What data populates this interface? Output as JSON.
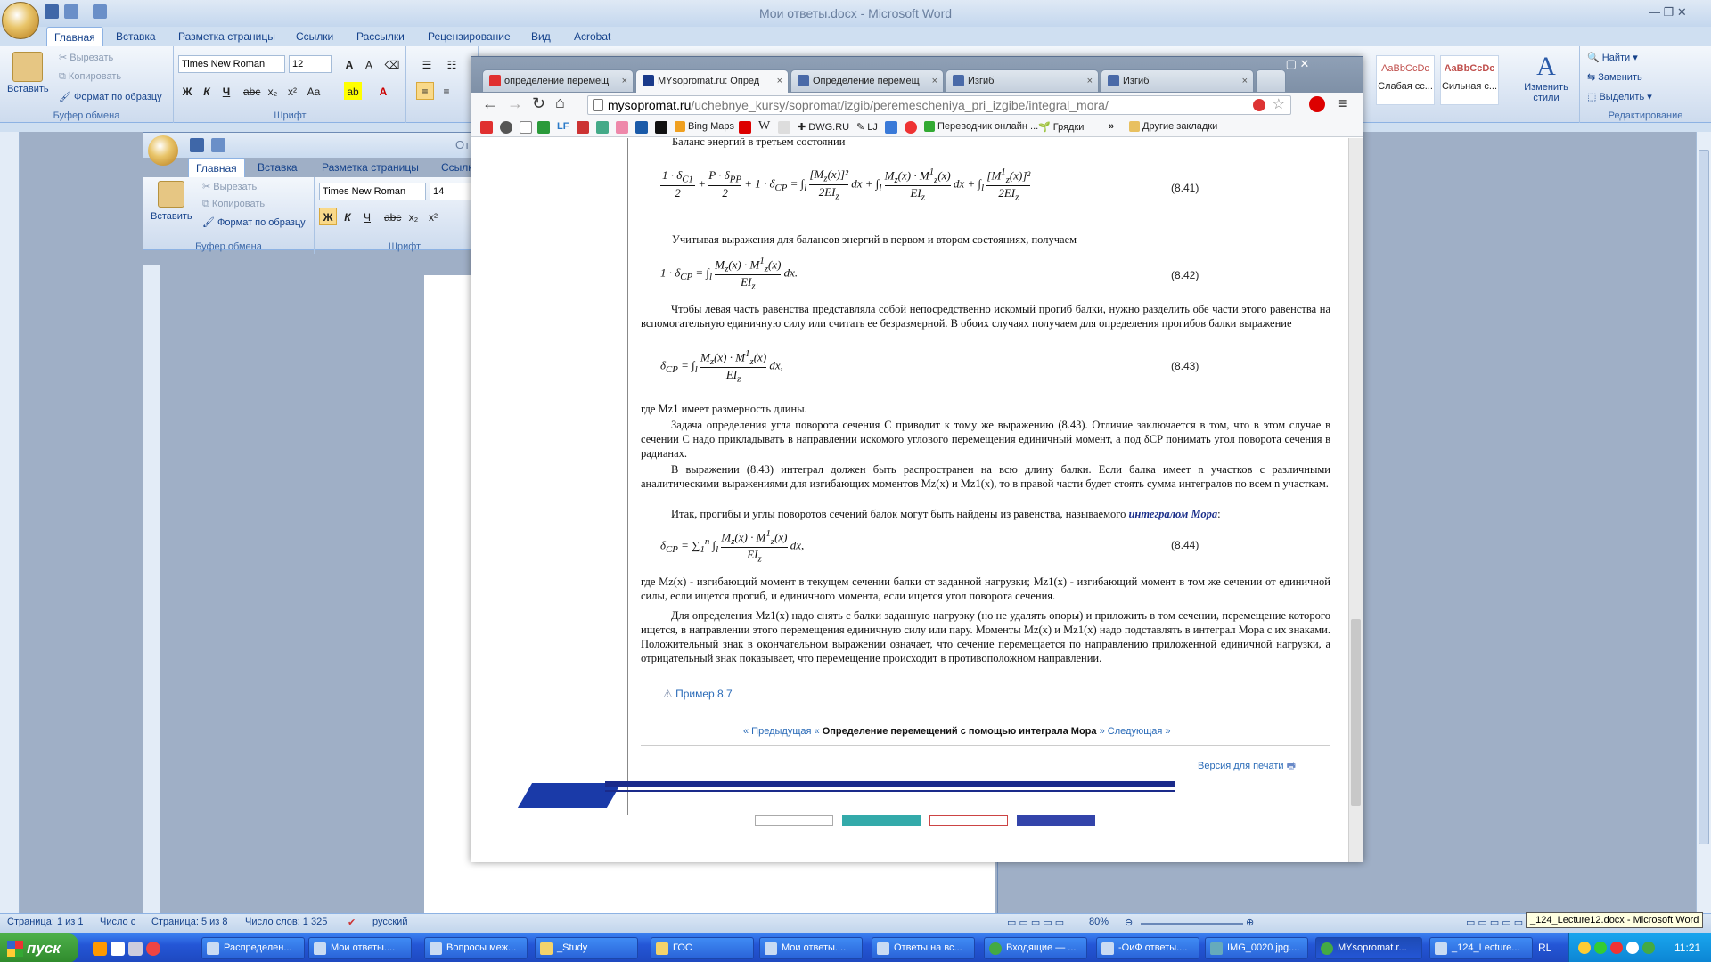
{
  "word_main": {
    "title": "Мои ответы.docx - Microsoft Word",
    "tabs": [
      "Главная",
      "Вставка",
      "Разметка страницы",
      "Ссылки",
      "Рассылки",
      "Рецензирование",
      "Вид",
      "Acrobat"
    ],
    "clipboard": {
      "paste": "Вставить",
      "cut": "Вырезать",
      "copy": "Копировать",
      "format": "Формат по образцу",
      "label": "Буфер обмена"
    },
    "font": {
      "name": "Times New Roman",
      "size": "12",
      "label": "Шрифт"
    },
    "styles": [
      {
        "sample": "AaBbCcDc",
        "name": "Слабая сс..."
      },
      {
        "sample": "AaBbCcDc",
        "name": "Сильная с..."
      }
    ],
    "change_styles": "Изменить стили",
    "editing": {
      "find": "Найти",
      "replace": "Заменить",
      "select": "Выделить",
      "label": "Редактирование"
    },
    "status": {
      "page": "Страница: 1 из 1",
      "number": "Число с",
      "page2": "Страница: 5 из 8",
      "words": "Число слов: 1 325",
      "lang": "русский",
      "zoom": "80%"
    },
    "tooltip": "_124_Lecture12.docx - Microsoft Word"
  },
  "word_second": {
    "title": "От",
    "tabs": [
      "Главная",
      "Вставка",
      "Разметка страницы",
      "Ссылк"
    ],
    "clipboard": {
      "paste": "Вставить",
      "cut": "Вырезать",
      "copy": "Копировать",
      "format": "Формат по образцу",
      "label": "Буфер обмена"
    },
    "font": {
      "name": "Times New Roman",
      "size": "14",
      "label": "Шрифт"
    }
  },
  "browser": {
    "tabs": [
      {
        "title": "определение перемещ",
        "color": "#e03030"
      },
      {
        "title": "MYsopromat.ru: Опред",
        "color": "#1a3a8a"
      },
      {
        "title": "Определение перемещ",
        "color": "#4a6aa8"
      },
      {
        "title": "Изгиб",
        "color": "#4a6aa8"
      },
      {
        "title": "Изгиб",
        "color": "#4a6aa8"
      }
    ],
    "url_host": "mysopromat.ru",
    "url_path": "/uchebnye_kursy/sopromat/izgib/peremescheniya_pri_izgibe/integral_mora/",
    "bookmarks": [
      "LF",
      "Bing Maps",
      "W",
      "DWG.RU",
      "LJ",
      "Переводчик онлайн ...",
      "Грядки",
      "Другие закладки"
    ],
    "page": {
      "p1": "Баланс энергий в третьем состоянии",
      "eq841": "(8.41)",
      "p2": "Учитывая выражения для балансов энергий в первом и втором состояниях, получаем",
      "eq842": "(8.42)",
      "p3": "Чтобы левая часть равенства представляла собой непосредственно искомый прогиб балки, нужно разделить обе части этого равенства на вспомогательную единичную силу или считать ее безразмерной. В обоих случаях получаем для определения прогибов балки выражение",
      "eq843": "(8.43)",
      "p4": "где Mz1 имеет размерность длины.",
      "p5": "Задача определения угла поворота сечения C приводит к тому же выражению (8.43). Отличие заключается в том, что в этом случае в сечении C надо прикладывать в направлении искомого углового перемещения единичный момент, а под δCP понимать угол поворота сечения в радианах.",
      "p6": "В выражении (8.43) интеграл должен быть распространен на всю длину балки. Если балка имеет n участков с различными аналитическими выражениями для изгибающих моментов Mz(x) и Mz1(x), то в правой части будет стоять сумма интегралов по всем n участкам.",
      "p7a": "Итак, прогибы и углы поворотов сечений балок могут быть найдены из равенства, называемого",
      "p7b": "интегралом Мора",
      "eq844": "(8.44)",
      "p8": "где Mz(x) - изгибающий момент в текущем сечении балки от заданной нагрузки; Mz1(x) - изгибающий момент в том же сечении от единичной силы, если ищется прогиб, и единичного момента, если ищется угол поворота сечения.",
      "p9": "Для определения Mz1(x) надо снять с балки заданную нагрузку (но не удалять опоры) и приложить в том сечении, перемещение которого ищется, в направлении этого перемещения единичную силу или пару. Моменты Mz(x) и Mz1(x) надо подставлять в интеграл Мора с их знаками. Положительный знак в окончательном выражении означает, что сечение перемещается по направлению приложенной единичной нагрузки, а отрицательный знак показывает, что перемещение происходит в противоположном направлении.",
      "example": "Пример 8.7",
      "prev": "« Предыдущая",
      "current": "Определение перемещений с помощью интеграла Мора",
      "next": "Следующая »",
      "print": "Версия для печати"
    }
  },
  "taskbar": {
    "start": "пуск",
    "items": [
      "Распределен...",
      "Мои ответы....",
      "Вопросы меж...",
      "_Study",
      "ГОС",
      "Мои ответы....",
      "Ответы на вс...",
      "Входящие — ...",
      "-ОиФ ответы....",
      "IMG_0020.jpg....",
      "MYsopromat.r...",
      "_124_Lecture..."
    ],
    "lang": "RL",
    "time": "11:21"
  }
}
